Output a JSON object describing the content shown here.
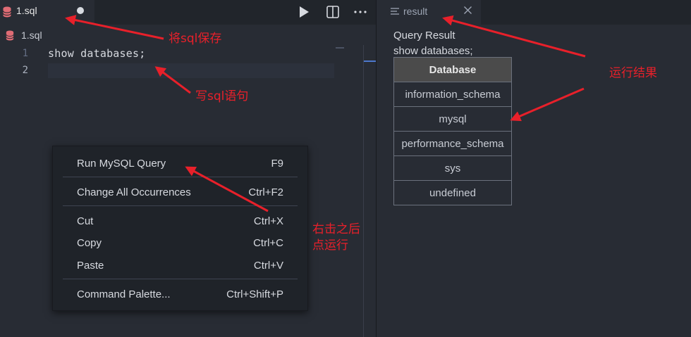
{
  "editor": {
    "tab": {
      "title": "1.sql",
      "icon": "database-icon",
      "modified": true
    },
    "toolbar": [
      "run-icon",
      "split-editor-icon",
      "more-icon"
    ],
    "breadcrumb": "1.sql",
    "line_numbers": [
      "1",
      "2"
    ],
    "lines": [
      "show databases;",
      ""
    ]
  },
  "context_menu": {
    "items": [
      {
        "label": "Run MySQL Query",
        "shortcut": "F9"
      },
      {
        "label": "Change All Occurrences",
        "shortcut": "Ctrl+F2"
      },
      {
        "label": "Cut",
        "shortcut": "Ctrl+X"
      },
      {
        "label": "Copy",
        "shortcut": "Ctrl+C"
      },
      {
        "label": "Paste",
        "shortcut": "Ctrl+V"
      },
      {
        "label": "Command Palette...",
        "shortcut": "Ctrl+Shift+P"
      }
    ]
  },
  "result": {
    "tab_title": "result",
    "heading": "Query Result",
    "query": "show databases;",
    "table": {
      "header": "Database",
      "rows": [
        "information_schema",
        "mysql",
        "performance_schema",
        "sys",
        "undefined"
      ]
    }
  },
  "annotations": {
    "save": "将sql保存",
    "write": "写sql语句",
    "result": "运行结果",
    "run_line1": "右击之后",
    "run_line2": "点运行"
  },
  "colors": {
    "annotation": "#e8202a",
    "database_icon": "#e06c75"
  }
}
